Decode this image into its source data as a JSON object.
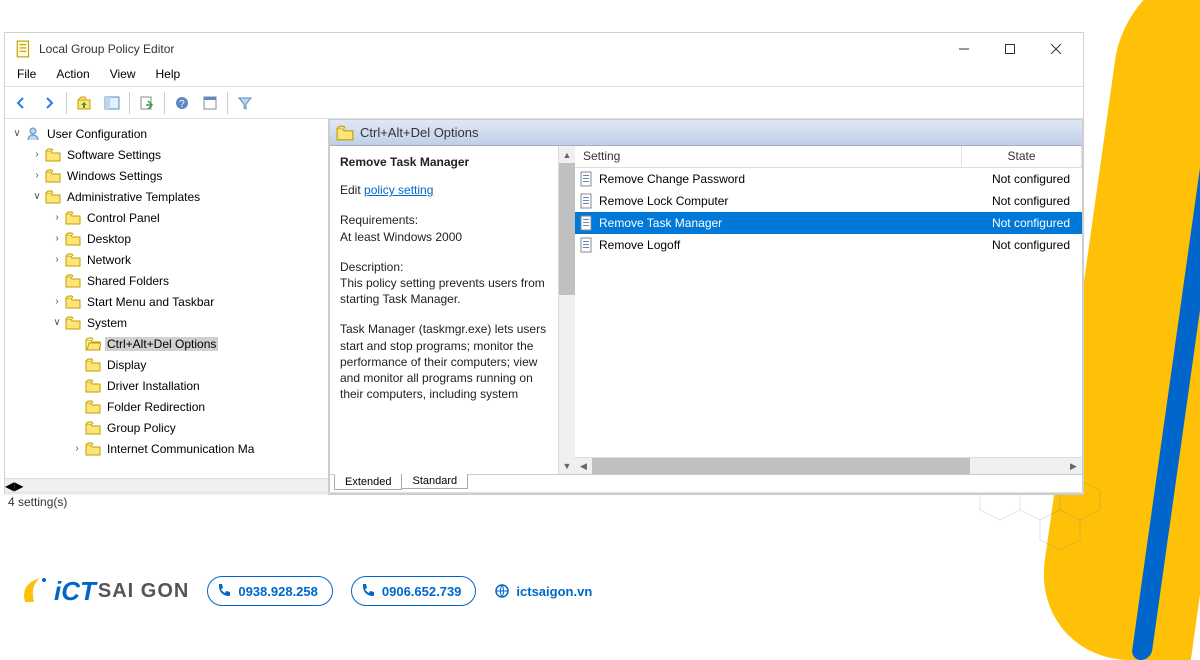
{
  "window": {
    "title": "Local Group Policy Editor",
    "menus": [
      "File",
      "Action",
      "View",
      "Help"
    ],
    "status": "4 setting(s)"
  },
  "tree": {
    "root": "User Configuration",
    "items": [
      {
        "label": "Software Settings",
        "depth": 1,
        "chev": ">"
      },
      {
        "label": "Windows Settings",
        "depth": 1,
        "chev": ">"
      },
      {
        "label": "Administrative Templates",
        "depth": 1,
        "chev": "v"
      },
      {
        "label": "Control Panel",
        "depth": 2,
        "chev": ">"
      },
      {
        "label": "Desktop",
        "depth": 2,
        "chev": ">"
      },
      {
        "label": "Network",
        "depth": 2,
        "chev": ">"
      },
      {
        "label": "Shared Folders",
        "depth": 2,
        "chev": ""
      },
      {
        "label": "Start Menu and Taskbar",
        "depth": 2,
        "chev": ">"
      },
      {
        "label": "System",
        "depth": 2,
        "chev": "v"
      },
      {
        "label": "Ctrl+Alt+Del Options",
        "depth": 3,
        "chev": "",
        "selected": true,
        "open": true
      },
      {
        "label": "Display",
        "depth": 3,
        "chev": ""
      },
      {
        "label": "Driver Installation",
        "depth": 3,
        "chev": ""
      },
      {
        "label": "Folder Redirection",
        "depth": 3,
        "chev": ""
      },
      {
        "label": "Group Policy",
        "depth": 3,
        "chev": ""
      },
      {
        "label": "Internet Communication Ma",
        "depth": 3,
        "chev": ">"
      }
    ]
  },
  "details": {
    "header": "Ctrl+Alt+Del Options",
    "policy_title": "Remove Task Manager",
    "edit_prefix": "Edit ",
    "edit_link": "policy setting ",
    "req_label": "Requirements:",
    "req_text": "At least Windows 2000",
    "desc_label": "Description:",
    "desc_p1": "This policy setting prevents users from starting Task Manager.",
    "desc_p2": "Task Manager (taskmgr.exe) lets users start and stop programs; monitor the performance of their computers; view and monitor all programs running on their computers, including system",
    "columns": {
      "setting": "Setting",
      "state": "State"
    },
    "rows": [
      {
        "name": "Remove Change Password",
        "state": "Not configured",
        "sel": false
      },
      {
        "name": "Remove Lock Computer",
        "state": "Not configured",
        "sel": false
      },
      {
        "name": "Remove Task Manager",
        "state": "Not configured",
        "sel": true
      },
      {
        "name": "Remove Logoff",
        "state": "Not configured",
        "sel": false
      }
    ],
    "tabs": [
      "Extended",
      "Standard"
    ]
  },
  "branding": {
    "logo_part1": "iCT",
    "logo_part2": "SAI GON",
    "phone1": "0938.928.258",
    "phone2": "0906.652.739",
    "site": "ictsaigon.vn"
  }
}
